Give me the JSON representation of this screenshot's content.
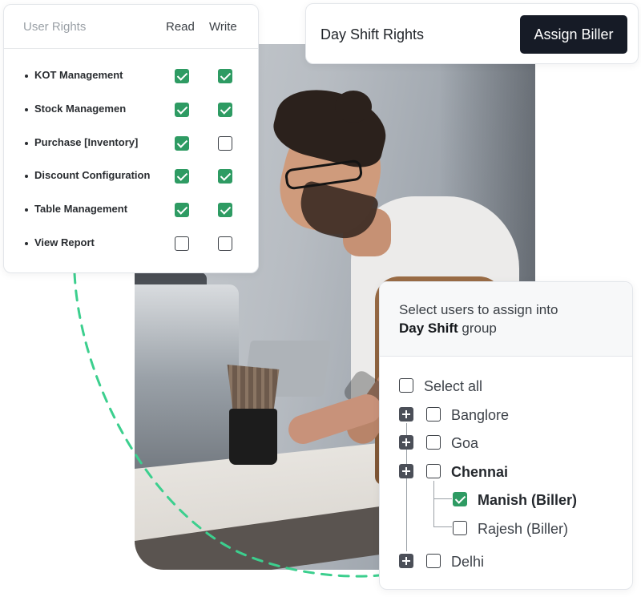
{
  "user_rights": {
    "header": {
      "title": "User Rights",
      "read": "Read",
      "write": "Write"
    },
    "rows": [
      {
        "label": "KOT Management",
        "read": true,
        "write": true
      },
      {
        "label": "Stock Managemen",
        "read": true,
        "write": true
      },
      {
        "label": "Purchase [Inventory]",
        "read": true,
        "write": false
      },
      {
        "label": "Discount Configuration",
        "read": true,
        "write": true
      },
      {
        "label": "Table Management",
        "read": true,
        "write": true
      },
      {
        "label": "View Report",
        "read": false,
        "write": false
      }
    ]
  },
  "shift": {
    "title": "Day Shift Rights",
    "button": "Assign Biller"
  },
  "users": {
    "prompt_line1": "Select users to assign into",
    "prompt_group": "Day Shift",
    "prompt_suffix": " group",
    "select_all": "Select all",
    "groups": [
      {
        "name": "Banglore",
        "checked": false
      },
      {
        "name": "Goa",
        "checked": false
      },
      {
        "name": "Chennai",
        "checked": false,
        "expanded": true,
        "children": [
          {
            "name": "Manish (Biller)",
            "checked": true
          },
          {
            "name": "Rajesh (Biller)",
            "checked": false
          }
        ]
      },
      {
        "name": "Delhi",
        "checked": false
      }
    ]
  },
  "colors": {
    "check_green": "#2e9b63",
    "button_dark": "#161b26",
    "arc_green": "#3ccf8e"
  },
  "icons": {
    "expand": "plus-icon",
    "checkbox": "checkbox-icon"
  }
}
